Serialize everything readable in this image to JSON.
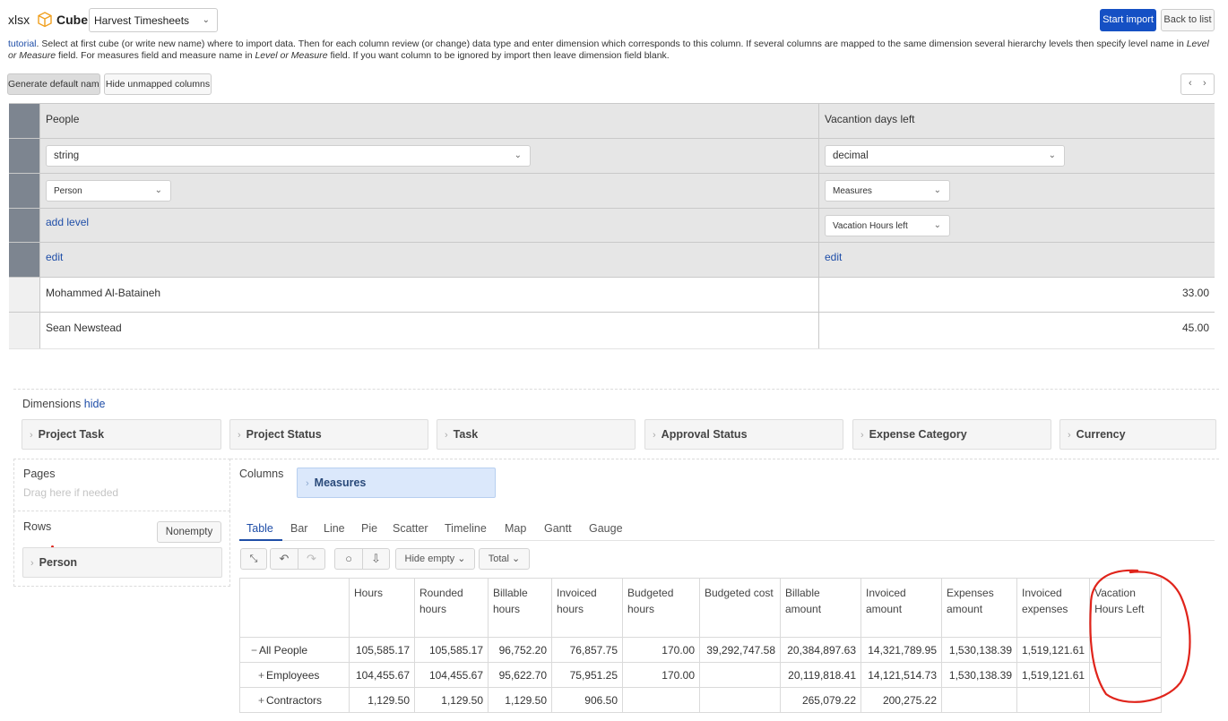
{
  "header": {
    "format": "xlsx",
    "cube_label": "Cube:",
    "cube_value": "Harvest Timesheets",
    "start_import": "Start import",
    "back_to_list": "Back to list"
  },
  "help": {
    "link": "tutorial",
    "t1": ". Select at first cube (or write new name) where to import data. Then for each column review (or change) data type and enter dimension which corresponds to this column. If several columns are mapped to the same dimension several hierarchy levels then specify level name in ",
    "i1": "Level or Measure",
    "t2": " field. For measures field and measure name in ",
    "i2": "Level or Measure",
    "t3": " field. If you want column to be ignored by import then leave dimension field blank."
  },
  "toolbar": {
    "generate": "Generate default names",
    "hide_unmapped": "Hide unmapped columns"
  },
  "mapping": {
    "col_a": {
      "name": "People",
      "type": "string",
      "dimension": "Person",
      "level_link": "add level",
      "edit": "edit"
    },
    "col_b": {
      "name": "Vacantion days left",
      "type": "decimal",
      "dimension": "Measures",
      "level": "Vacation Hours left",
      "edit": "edit"
    },
    "rows": [
      {
        "a": "Mohammed Al-Bataineh",
        "b": "33.00"
      },
      {
        "a": "Sean Newstead",
        "b": "45.00"
      }
    ]
  },
  "analysis": {
    "dimensions_label": "Dimensions",
    "hide_link": "hide",
    "dimensions": [
      "Project Task",
      "Project Status",
      "Task",
      "Approval Status",
      "Expense Category",
      "Currency"
    ],
    "pages_label": "Pages",
    "pages_hint": "Drag here if needed",
    "columns_label": "Columns",
    "columns_chip": "Measures",
    "rows_label": "Rows",
    "nonempty": "Nonempty",
    "rows_chip": "Person",
    "tabs": [
      "Table",
      "Bar",
      "Line",
      "Pie",
      "Scatter",
      "Timeline",
      "Map",
      "Gantt",
      "Gauge"
    ],
    "hide_empty": "Hide empty",
    "total": "Total"
  },
  "results": {
    "headers": [
      "Hours",
      "Rounded hours",
      "Billable hours",
      "Invoiced hours",
      "Budgeted hours",
      "Budgeted cost",
      "Billable amount",
      "Invoiced amount",
      "Expenses amount",
      "Invoiced expenses",
      "Vacation Hours Left"
    ],
    "rows": [
      {
        "label": "All People",
        "expander": "−",
        "values": [
          "105,585.17",
          "105,585.17",
          "96,752.20",
          "76,857.75",
          "170.00",
          "39,292,747.58",
          "20,384,897.63",
          "14,321,789.95",
          "1,530,138.39",
          "1,519,121.61",
          ""
        ]
      },
      {
        "label": "Employees",
        "expander": "+",
        "values": [
          "104,455.67",
          "104,455.67",
          "95,622.70",
          "75,951.25",
          "170.00",
          "",
          "20,119,818.41",
          "14,121,514.73",
          "1,530,138.39",
          "1,519,121.61",
          ""
        ]
      },
      {
        "label": "Contractors",
        "expander": "+",
        "values": [
          "1,129.50",
          "1,129.50",
          "1,129.50",
          "906.50",
          "",
          "",
          "265,079.22",
          "200,275.22",
          "",
          "",
          ""
        ]
      }
    ]
  },
  "colors": {
    "primary": "#1550c4",
    "link": "#1f4ea8",
    "annotation": "#e0241b",
    "measures_chip": "#dbe8fb"
  }
}
